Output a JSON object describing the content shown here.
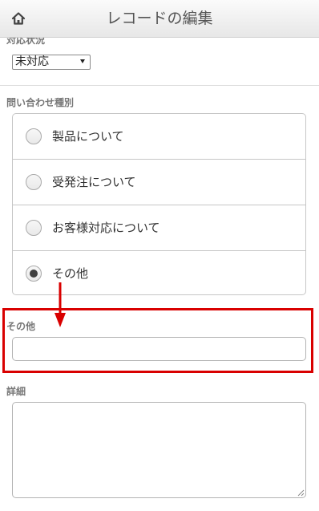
{
  "header": {
    "title": "レコードの編集",
    "home_icon": "home-icon"
  },
  "status": {
    "label": "対応状況",
    "selected": "未対応"
  },
  "inquiry_type": {
    "label": "問い合わせ種別",
    "options": [
      {
        "label": "製品について",
        "checked": false
      },
      {
        "label": "受発注について",
        "checked": false
      },
      {
        "label": "お客様対応について",
        "checked": false
      },
      {
        "label": "その他",
        "checked": true
      }
    ]
  },
  "other": {
    "label": "その他",
    "value": ""
  },
  "details": {
    "label": "詳細",
    "value": ""
  },
  "colors": {
    "highlight": "#d90000",
    "label_text": "#777777",
    "border": "#c6c6c6"
  }
}
